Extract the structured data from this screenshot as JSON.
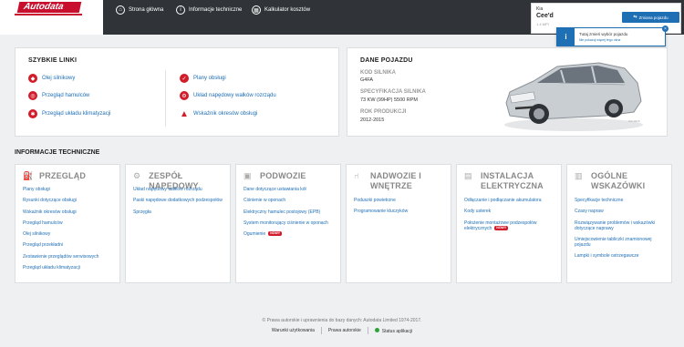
{
  "header": {
    "logo_text": "Autodata",
    "nav": [
      {
        "label": "Strona główna",
        "icon": "home-icon"
      },
      {
        "label": "Informacje techniczne",
        "icon": "info-icon"
      },
      {
        "label": "Kalkulator kosztów",
        "icon": "calculator-icon"
      }
    ],
    "vehicle": {
      "make": "Kia",
      "model": "Cee'd",
      "engine": "1.4 MPI",
      "change_button": "Zmiana pojazdu"
    },
    "tooltip": {
      "title": "Tutaj zmień wybór pojazdu",
      "link": "Nie pokazuj więcej tego okna"
    }
  },
  "quick_links": {
    "title": "SZYBKIE LINKI",
    "left": [
      {
        "label": "Olej silnikowy",
        "icon": "oil-can-icon"
      },
      {
        "label": "Przegląd hamulców",
        "icon": "brake-disc-icon"
      },
      {
        "label": "Przegląd układu klimatyzacji",
        "icon": "snowflake-icon"
      }
    ],
    "right": [
      {
        "label": "Plany obsługi",
        "icon": "checkmark-icon"
      },
      {
        "label": "Układ napędowy wałków rozrządu",
        "icon": "timing-belt-icon"
      },
      {
        "label": "Wskaźnik okresów obsługi",
        "icon": "warning-triangle-icon"
      }
    ]
  },
  "vehicle_data": {
    "title": "DANE POJAZDU",
    "fields": [
      {
        "label": "KOD SILNIKA",
        "value": "G4FA"
      },
      {
        "label": "SPECYFIKACJA SILNIKA",
        "value": "73 KW (99HP) 5500 RPM"
      },
      {
        "label": "ROK PRODUKCJI",
        "value": "2012-2015"
      }
    ]
  },
  "technical": {
    "title": "INFORMACJE TECHNICZNE",
    "categories": [
      {
        "title": "PRZEGLĄD",
        "icon": "oil-can-icon",
        "items": [
          "Plany obsługi",
          "Rysunki dotyczące obsługi",
          "Wskaźnik okresów obsługi",
          "Przegląd hamulców",
          "Olej silnikowy",
          "Przegląd przekładni",
          "Zestawienie przeglądów serwisowych",
          "Przegląd układu klimatyzacji"
        ]
      },
      {
        "title": "ZESPÓŁ NAPĘDOWY",
        "icon": "engine-icon",
        "items": [
          "Układ napędowy wałków rozrządu",
          "Paski napędowe dodatkowych podzespołów",
          "Sprzęgła"
        ]
      },
      {
        "title": "PODWOZIE",
        "icon": "chassis-icon",
        "items": [
          "Dane dotyczące ustawiania kół",
          "Ciśnienie w oponach",
          "Elektryczny hamulec postojowy (EPB)",
          "System monitorujący ciśnienie w oponach",
          "Ogumienie"
        ],
        "new_badge": "NOWY"
      },
      {
        "title": "NADWOZIE I WNĘTRZE",
        "icon": "seat-icon",
        "items": [
          "Poduszki powietrzne",
          "Programowanie kluczyków"
        ]
      },
      {
        "title": "INSTALACJA ELEKTRYCZNA",
        "icon": "battery-icon",
        "items": [
          "Odłączanie i podłączanie akumulatora",
          "Kody usterek",
          "Położenie montażowe podzespołów elektrycznych"
        ],
        "new_badge": "NOWY"
      },
      {
        "title": "OGÓLNE WSKAZÓWKI",
        "icon": "toolbox-icon",
        "items": [
          "Specyfikacje techniczne",
          "Czasy napraw",
          "Rozwiązywanie problemów i wskazówki dotyczące naprawy",
          "Umiejscowienie tabliczki znamionowej pojazdu",
          "Lampki i symbole ostrzegawcze"
        ]
      }
    ]
  },
  "footer": {
    "copyright": "© Prawa autorskie i uprawnienia do bazy danych: Autodata Limited 1974-2017.",
    "links": [
      "Warunki użytkowania",
      "Prawa autorskie",
      "Status aplikacji"
    ]
  }
}
